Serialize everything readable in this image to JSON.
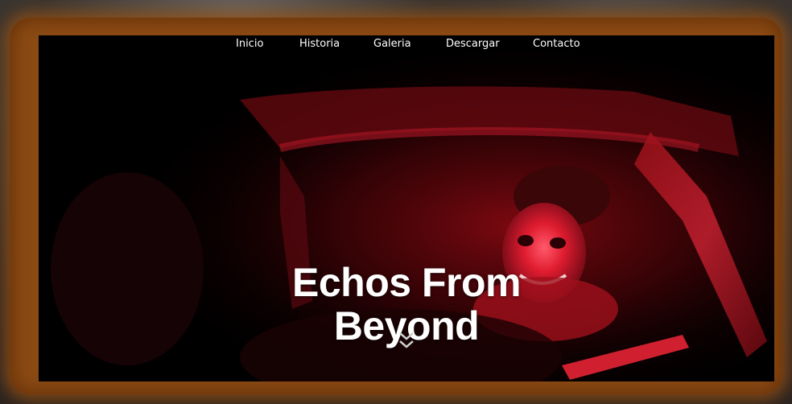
{
  "nav": {
    "items": [
      {
        "label": "Inicio"
      },
      {
        "label": "Historia"
      },
      {
        "label": "Galeria"
      },
      {
        "label": "Descargar"
      },
      {
        "label": "Contacto"
      }
    ]
  },
  "hero": {
    "title_line1": "Echos From",
    "title_line2": "Beyond",
    "background_image": "clown-in-vehicle-red-light"
  },
  "icons": {
    "scroll": "double-chevron-down-icon"
  },
  "colors": {
    "frame": "#8a4a14",
    "accent_red": "#c4121c",
    "text": "#ffffff",
    "background": "#000000"
  }
}
